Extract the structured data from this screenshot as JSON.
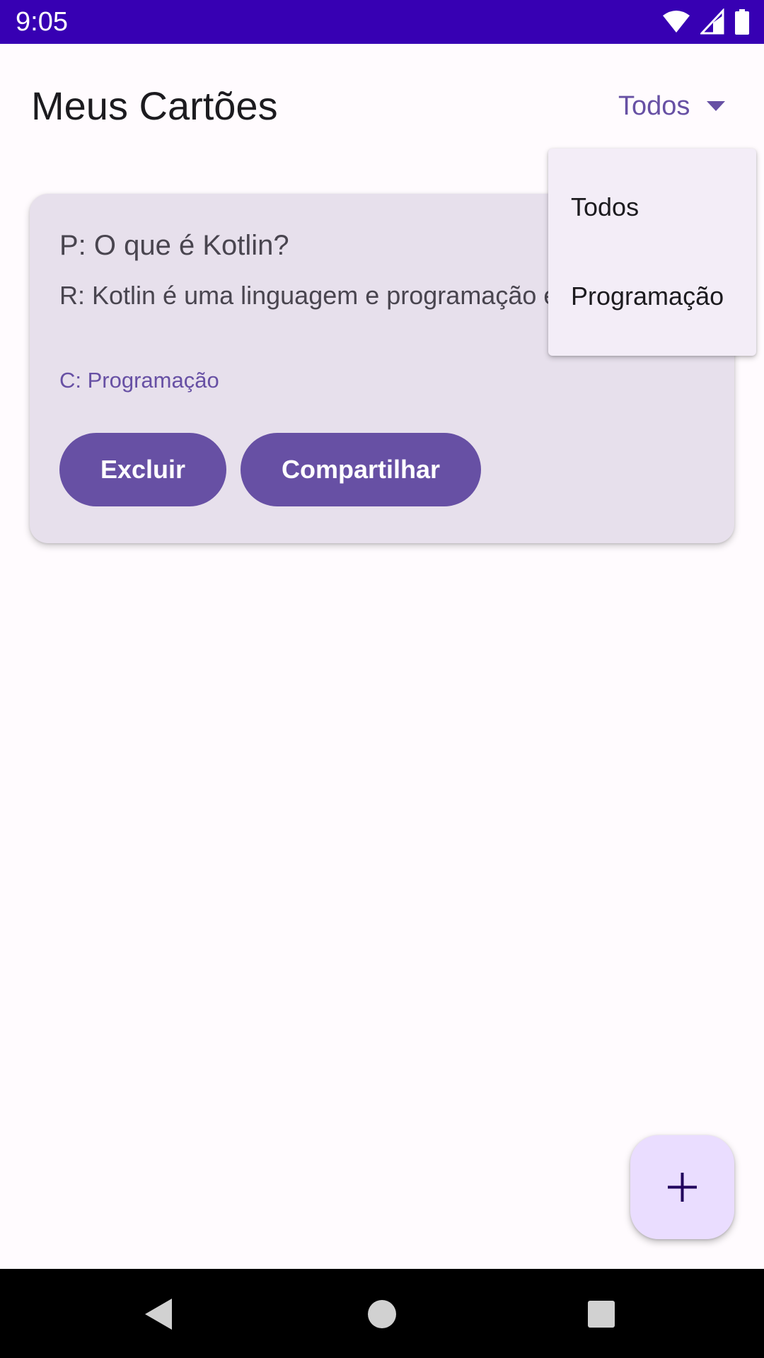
{
  "status_bar": {
    "time": "9:05",
    "icons": [
      "wifi-icon",
      "signal-icon",
      "battery-icon"
    ]
  },
  "header": {
    "title": "Meus Cartões",
    "filter_selected": "Todos"
  },
  "card": {
    "question": "P: O que é Kotlin?",
    "answer": "R: Kotlin é uma linguagem e programação est...",
    "category": "C: Programação",
    "delete_label": "Excluir",
    "share_label": "Compartilhar"
  },
  "dropdown_menu": {
    "items": [
      {
        "label": "Todos"
      },
      {
        "label": "Programação"
      }
    ]
  },
  "fab": {
    "icon": "plus-icon"
  },
  "nav_bar": {
    "icons": [
      "back-icon",
      "home-icon",
      "recents-icon"
    ]
  },
  "colors": {
    "status_bar": "#3700B3",
    "primary": "#6750A4",
    "card_background": "#E7E0EC",
    "menu_background": "#F3EDF7",
    "fab_background": "#EADDFF",
    "page_background": "#FFFBFE"
  }
}
